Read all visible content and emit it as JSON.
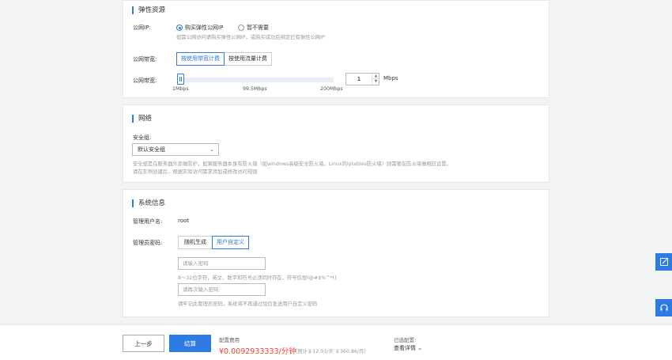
{
  "elastic": {
    "title": "弹性资源",
    "public_ip_label": "公网IP:",
    "ip_opt_buy": "购买弹性公网IP",
    "ip_opt_none": "暂不需要",
    "ip_hint": "如需公网访问请购买弹性公网IP，或购买成功后绑定已有弹性公网IP",
    "billing_label": "公网带宽:",
    "billing_by_bandwidth": "按使用带宽计费",
    "billing_by_traffic": "按使用流量计费",
    "bandwidth_label": "公网带宽:",
    "slider_fraction": 0.0,
    "tick_min": "1Mbps",
    "tick_mid": "99.5Mbps",
    "tick_max": "200Mbps",
    "bandwidth_value": "1",
    "unit": "Mbps"
  },
  "network": {
    "title": "网络",
    "sg_label": "安全组:",
    "sg_selected": "默认安全组",
    "hint1": "安全组是在服务器外部做防护，如果服务器本身有防火墙（如windows高级安全防火墙，Linux的iptables防火墙）则需要在防火墙做相应设置。",
    "hint2": "请在实例创建后，根据实际访问需求添加或修改访问规则"
  },
  "system": {
    "title": "系统信息",
    "admin_user_label": "管理用户名:",
    "admin_user_value": "root",
    "admin_pwd_label": "管理员密码:",
    "pwd_random": "随机生成",
    "pwd_custom": "用户自定义",
    "pwd_placeholder": "请输入密码",
    "pwd_rule": "8～32位字符，英文、数字和符号必须同时存在，符号仅限!@#$%^*()",
    "pwd_confirm_placeholder": "请再次输入密码",
    "pwd_note": "请牢记此管理员密码，系统将不再通过短信发送用户自定义密码"
  },
  "footer": {
    "prev": "上一步",
    "pay": "结算",
    "fee_label": "配置费用",
    "fee_price": "¥0.0092933333/分钟",
    "fee_est": "（预计￥12.03/天 ￥360.86/月）",
    "selected_label": "已选配置:",
    "view_detail": "查看详情"
  },
  "colors": {
    "accent": "#2c7be5",
    "price": "#e8452c"
  },
  "icons": {
    "side_top": "edit-icon",
    "side_bottom": "headset-icon"
  }
}
